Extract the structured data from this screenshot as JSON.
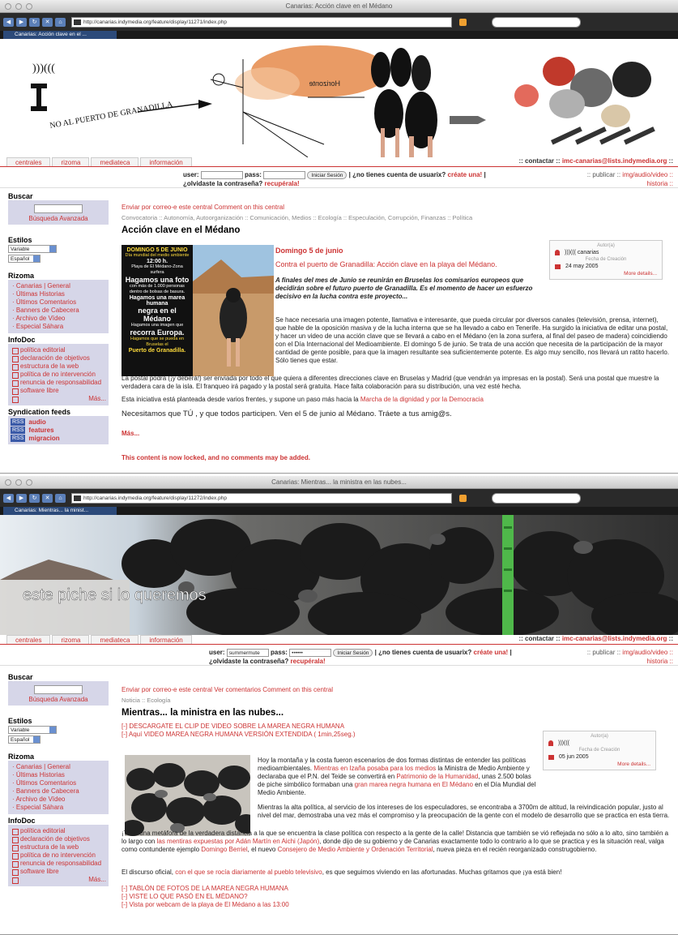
{
  "window1": {
    "title": "Canarias: Acción clave en el Médano",
    "url": "http://canarias.indymedia.org/feature/display/11271/index.php",
    "tab": "Canarias: Acción clave en el ...",
    "banner_text": "NO AL PUERTO DE GRANADILLA",
    "banner_sign": "Horizonte",
    "nav": [
      "centrales",
      "rizoma",
      "mediateca",
      "información"
    ],
    "contact_prefix": ":: contactar ::",
    "contact_email": "imc-canarias@lists.indymedia.org",
    "contact_suffix": "::",
    "login": {
      "user_label": "user:",
      "pass_label": "pass:",
      "user_value": "",
      "pass_value": "",
      "submit": "Iniciar Sesión",
      "no_account": "| ¿no tienes cuenta de usuarix?",
      "create": "créate una!",
      "forgot": "| ¿olvidaste la contraseña?",
      "recover": "recupérala!"
    },
    "publish_prefix": ":: publicar ::",
    "publish_link": "img/audio/video ::",
    "historia": "historia ::",
    "sidebar": {
      "search_title": "Buscar",
      "advanced": "Búsqueda Avanzada",
      "styles_title": "Estilos",
      "style_value": "Variable",
      "lang_value": "Español",
      "rizoma_title": "Rizoma",
      "rizoma_links": [
        "· Canarias | General",
        "· Últimas Historias",
        "· Últimos Comentarios",
        "· Banners de Cabecera",
        "· Archivo de Vídeo",
        "· Especial Sáhara"
      ],
      "infodoc_title": "InfoDoc",
      "infodoc_links": [
        "política editorial",
        "declaración de objetivos",
        "estructura de la web",
        "política de no intervención",
        "renuncia de responsabilidad",
        "software libre"
      ],
      "more": "Más...",
      "synd_title": "Syndication feeds",
      "rss_badge": "RSS",
      "feeds": [
        "audio",
        "features",
        "migracion"
      ]
    },
    "article": {
      "toplinks": "Enviar por correo-e este central   Comment on this central",
      "crumbs": "Convocatoria :: Autonomía, Autoorganización :: Comunicación, Medios :: Ecología :: Especulación, Corrupción, Finanzas :: Política",
      "title": "Acción clave en el Médano",
      "date_head": "Domingo 5 de junio",
      "subtitle": "Contra el puerto de Granadilla: Acción clave en la playa del Médano.",
      "lead": "A finales del mes de Junio se reunirán en Bruselas los comisarios europeos que decidirán sobre el futuro puerto de Granadilla. Es el momento de hacer un esfuerzo decisivo en la lucha contra este proyecto...",
      "p1": "Se hace necesaria una imagen potente, llamativa e interesante, que pueda circular por diversos canales (televisión, prensa, internet), que hable de la oposición masiva y de la lucha interna que se ha llevado a cabo en Tenerife. Ha surgido la iniciativa de editar una postal, y hacer un video de una acción clave que se llevará a cabo en el Médano (en la zona surfera, al final del paseo de madera) coincidiendo con el Día Internacional del Medioambiente. El domingo 5 de junio. Se trata de una acción que necesita de la participación de la mayor cantidad de gente posible, para que la imagen resultante sea suficientemente potente. Es algo muy sencillo, nos llevará un ratito hacerlo. Sólo tienes que estar.",
      "p2": "La postal podrá (¡y deberá!) ser enviada por todo el que quiera a diferentes direcciones clave en Bruselas y Madrid (que vendrán ya impresas en la postal). Será una postal que muestre la verdadera cara de la isla. El franqueo irá pagado y la postal será gratuita. Hace falta colaboración para su distribución, una vez esté hecha.",
      "p3_pre": "Esta iniciativa está planteada desde varios frentes, y supone un paso más hacia la ",
      "p3_link": "Marcha de la dignidad y por la Democracia",
      "p4": "Necesitamos que TÚ , y que todos participen. Ven el 5 de junio al Médano. Tráete a tus amig@s.",
      "more": "Más...",
      "locked": "This content is now locked, and no comments may be added."
    },
    "poster": {
      "l1": "DOMINGO 5 DE JUNIO",
      "l2": "Día mundial del medio ambiente",
      "l3": "12:00 h.",
      "l4": "Playa de El Médano-Zona surfera",
      "l5": "Hagamos una foto",
      "l6": "con más de 1.000 personas dentro de bolsas de basura.",
      "l7": "Hagamos una marea humana",
      "l8": "negra en el Médano",
      "l9": "Hagamos una imagen que",
      "l10": "recorra Europa.",
      "l11": "Hagamos que se pueda en Bruselas el",
      "l12": "Puerto de Granadilla."
    },
    "authbox": {
      "label": "Autor(a)",
      "author": ")))((( canarias",
      "date_label": "Fecha de Creación",
      "date": "24 may 2005",
      "more": "More details..."
    }
  },
  "window2": {
    "title": "Canarias: Mientras... la ministra en las nubes...",
    "url": "http://canarias.indymedia.org/feature/display/11272/index.php",
    "tab": "Canarias: Mientras... la minist...",
    "banner_text": "este piche si lo queremos",
    "nav": [
      "centrales",
      "rizoma",
      "mediateca",
      "información"
    ],
    "contact_prefix": ":: contactar ::",
    "contact_email": "imc-canarias@lists.indymedia.org",
    "contact_suffix": "::",
    "login": {
      "user_label": "user:",
      "pass_label": "pass:",
      "user_value": "summermute",
      "pass_value": "••••••",
      "submit": "Iniciar Sesión",
      "no_account": "| ¿no tienes cuenta de usuarix?",
      "create": "créate una!",
      "forgot": "| ¿olvidaste la contraseña?",
      "recover": "recupérala!"
    },
    "publish_prefix": ":: publicar ::",
    "publish_link": "img/audio/video ::",
    "historia": "historia ::",
    "sidebar": {
      "search_title": "Buscar",
      "advanced": "Búsqueda Avanzada",
      "styles_title": "Estilos",
      "style_value": "Variable",
      "lang_value": "Español",
      "rizoma_title": "Rizoma",
      "rizoma_links": [
        "· Canarias | General",
        "· Últimas Historias",
        "· Últimos Comentarios",
        "· Banners de Cabecera",
        "· Archivo de Vídeo",
        "· Especial Sáhara"
      ],
      "infodoc_title": "InfoDoc",
      "infodoc_links": [
        "política editorial",
        "declaración de objetivos",
        "estructura de la web",
        "política de no intervención",
        "renuncia de responsabilidad",
        "software libre"
      ],
      "more": "Más..."
    },
    "article": {
      "toplinks": "Enviar por correo-e este central   Ver comentarios   Comment on this central",
      "crumbs": "Noticia :: Ecología",
      "title": "Mientras... la ministra en las nubes...",
      "link1": "[-] DESCARGATE EL CLIP DE VIDEO SOBRE LA MAREA NEGRA HUMANA",
      "link2": "[-] Aquí VIDEO MAREA NEGRA HUMANA VERSIÓN EXTENDIDA ( 1min,25seg.)",
      "p1_a": "Hoy la montaña y la costa fueron escenarios de dos formas distintas de entender las políticas medioambientales. ",
      "p1_l1": "Mientras en Izaña posaba para los medios",
      "p1_b": " la Ministra de Medio Ambiente y declaraba que el P.N. del Teide se convertirá en ",
      "p1_l2": "Patrimonio de la Humanidad",
      "p1_c": ", unas 2.500 bolas de piche simbólico formaban una ",
      "p1_l3": "gran marea negra humana en El Médano",
      "p1_d": " en el Día Mundial del Medio Ambiente.",
      "p2": "Mientras la alta política, al servicio de los intereses de los especuladores, se encontraba a 3700m de altitud, la reivindicación popular, justo al nivel del mar, demostraba una vez más el compromiso y la preocupación de la gente con el modelo de desarrollo que se practica en esta tierra.",
      "p3_a": "¡Toda una metáfora de la verdadera distancia a la que se encuentra la clase política con respecto a la gente de la calle! Distancia que también se vió reflejada no sólo a lo alto, sino también a lo largo con ",
      "p3_l1": "las mentiras expuestas por Adán Martín en Aichi (Japón)",
      "p3_b": ", donde dijo de su gobierno y de Canarias exactamente todo lo contrario a lo que se practica y es la situación real, valga como contundente ejemplo ",
      "p3_l2": "Domingo Berriel",
      "p3_c": ", el nuevo ",
      "p3_l3": "Consejero de Medio Ambiente y Ordenación Territorial",
      "p3_d": ", nueva pieza en el recién reorganizado construgobierno.",
      "p4_a": "El discurso oficial, ",
      "p4_l": "con el que se rocía diariamente al pueblo televisivo",
      "p4_b": ", es que seguimos viviendo en las afortunadas. Muchas gritamos que ¡ya está bien!",
      "link3": "[-] TABLÓN DE FOTOS DE LA MAREA NEGRA HUMANA",
      "link4": "[-] VISTE LO QUE PASÓ EN EL MÉDANO?",
      "link5": "[-] Vista por webcam de la playa de El Médano a las 13:00"
    },
    "authbox": {
      "label": "Autor(a)",
      "author": ")))(((",
      "date_label": "Fecha de Creación",
      "date": "05 jun 2005",
      "more": "More details..."
    }
  }
}
